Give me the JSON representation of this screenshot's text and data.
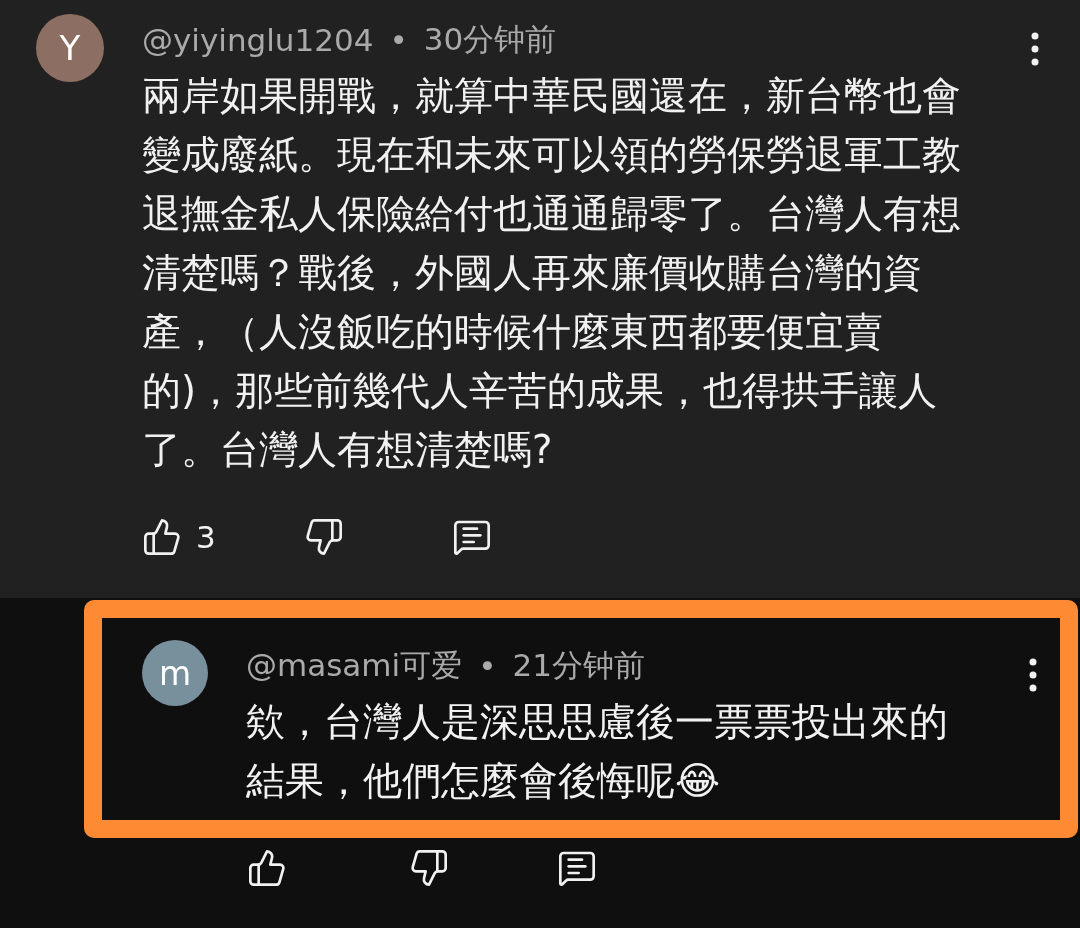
{
  "comments": [
    {
      "avatar_letter": "Y",
      "color": "#8d6e63",
      "author": "@yiyinglu1204",
      "separator": "•",
      "time": "30分钟前",
      "text": "兩岸如果開戰，就算中華民國還在，新台幣也會變成廢紙。現在和未來可以領的勞保勞退軍工教退撫金私人保險給付也通通歸零了。台灣人有想清楚嗎？戰後，外國人再來廉價收購台灣的資產，（人沒飯吃的時候什麼東西都要便宜賣的)，那些前幾代人辛苦的成果，也得拱手讓人了。台灣人有想清楚嗎?",
      "like_count": "3",
      "highlighted": false
    },
    {
      "avatar_letter": "m",
      "color": "#78909c",
      "author": "@masami可爱",
      "separator": "•",
      "time": "21分钟前",
      "text": "欸，台灣人是深思思慮後一票票投出來的結果，他們怎麼會後悔呢😂",
      "highlighted": true
    }
  ]
}
